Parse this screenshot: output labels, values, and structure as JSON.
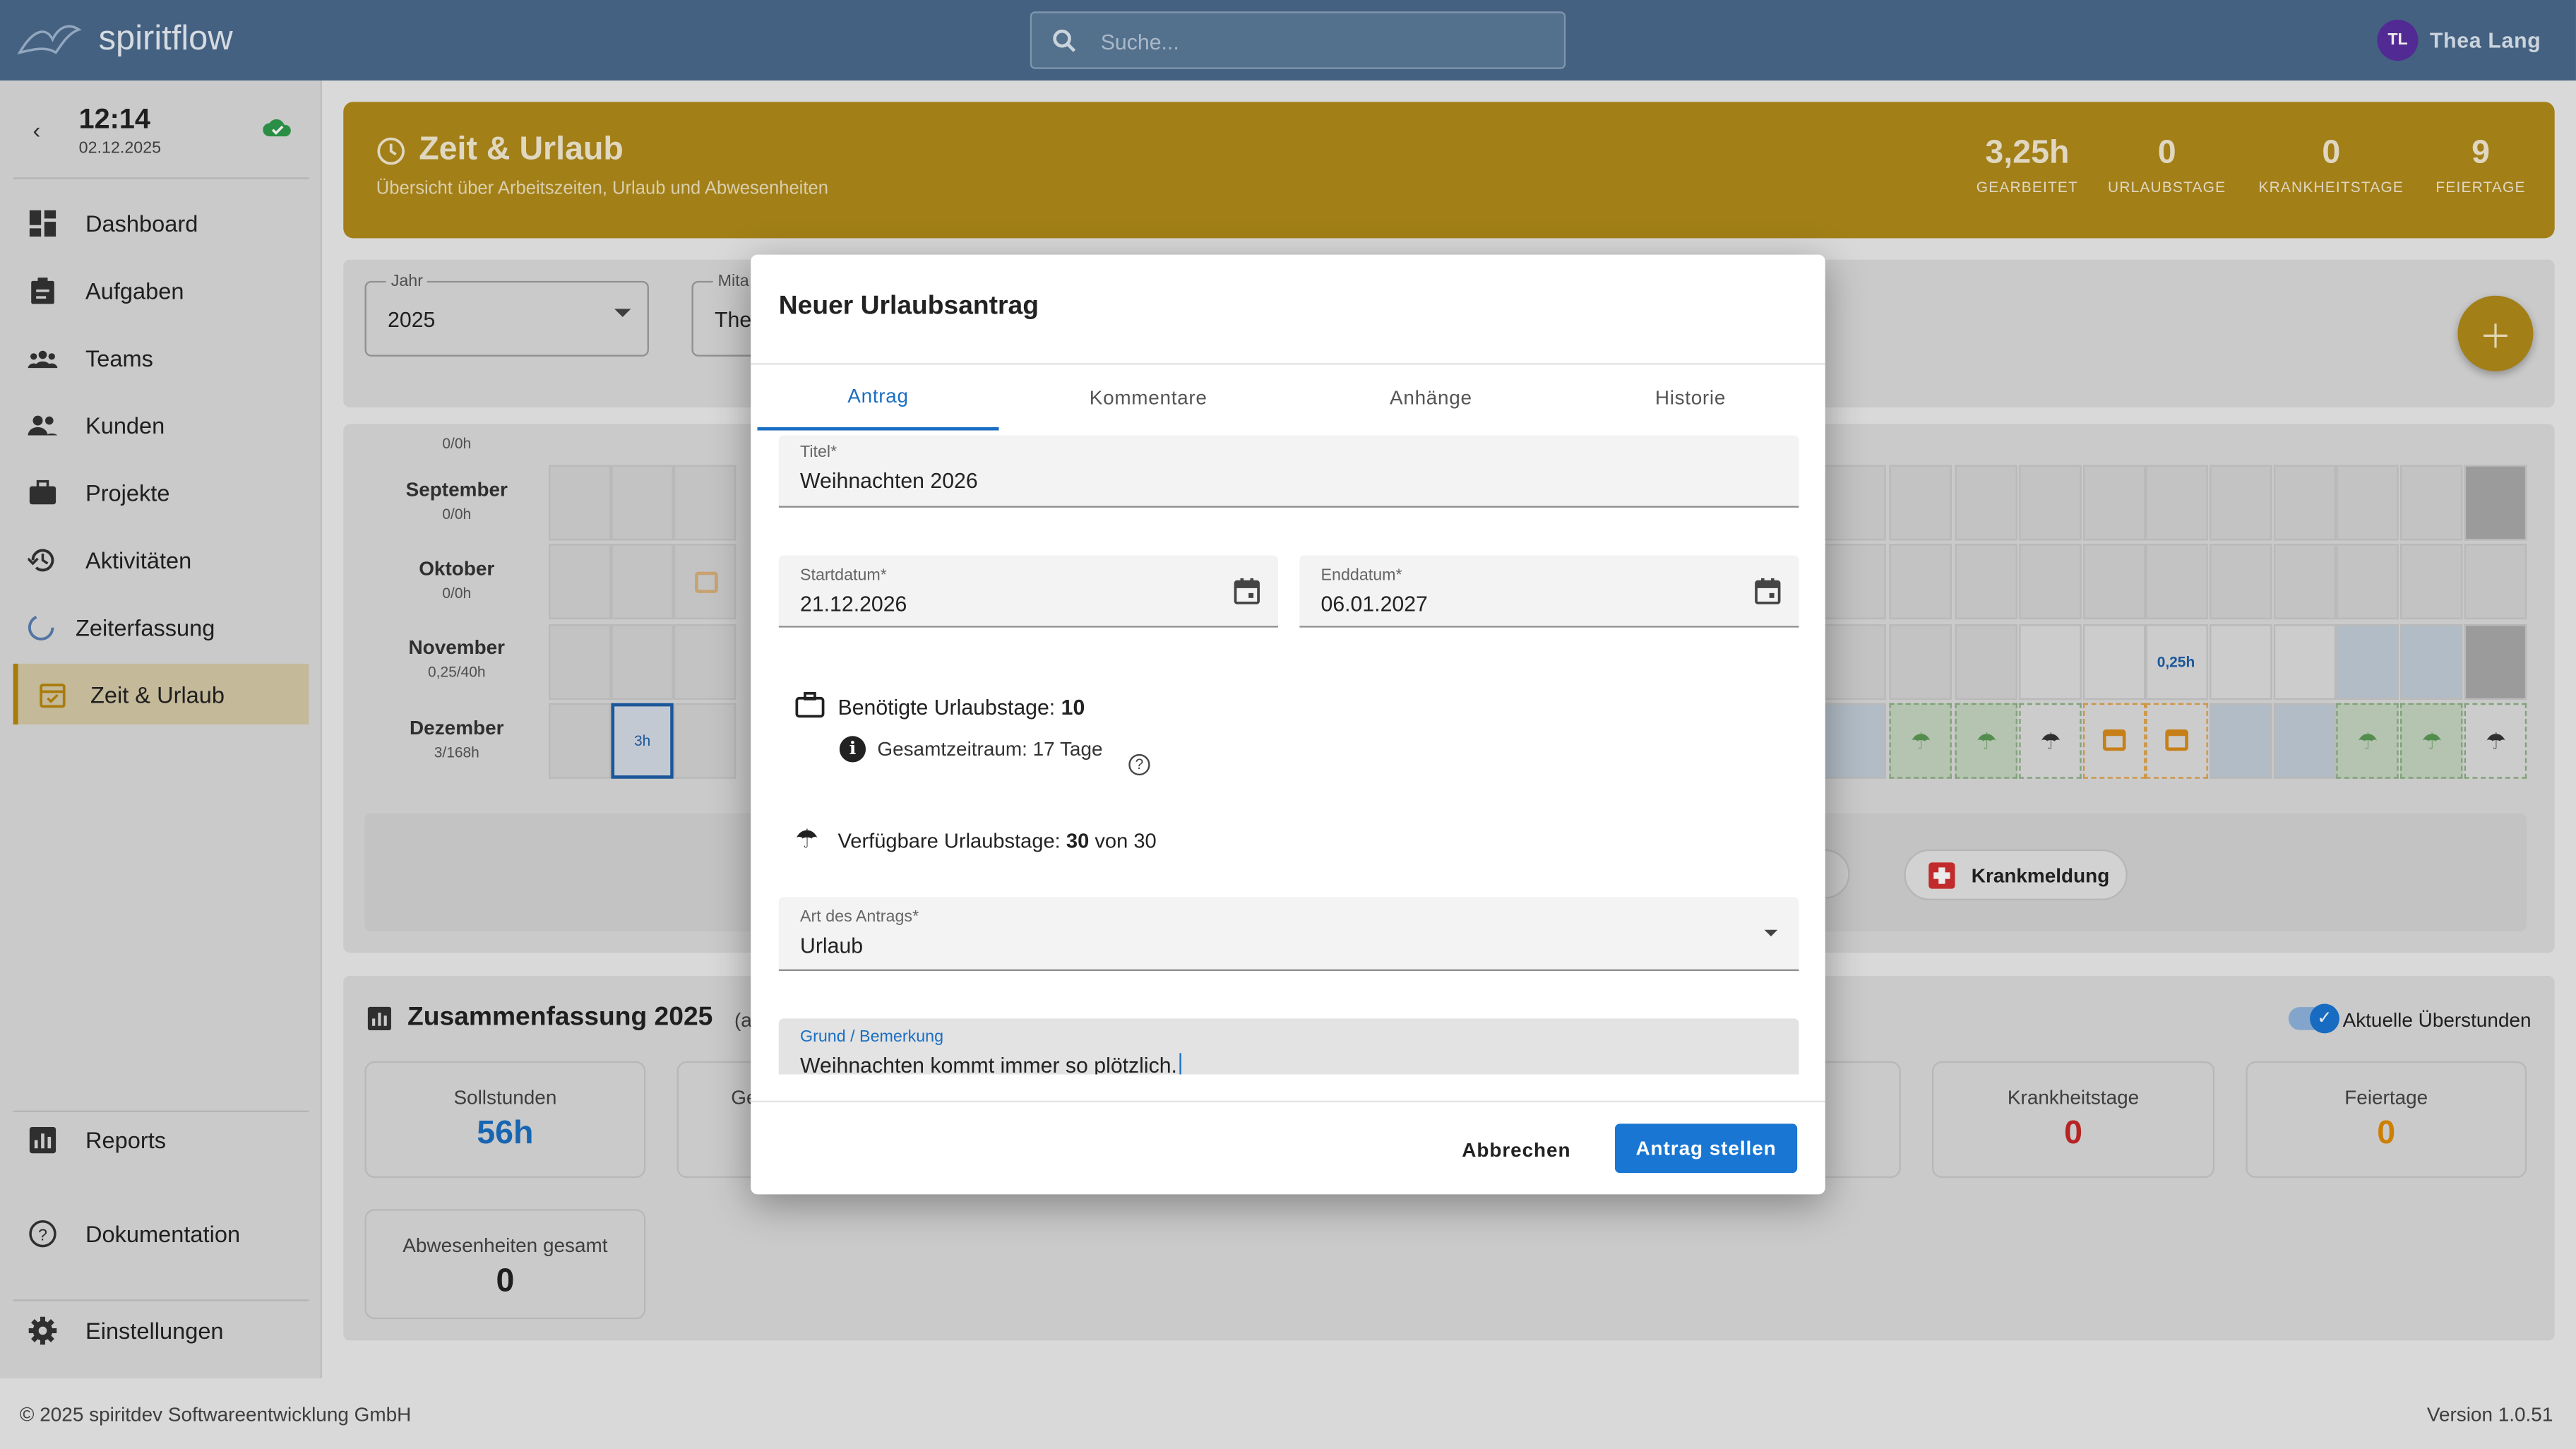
{
  "topbar": {
    "brand": "spiritflow",
    "search_placeholder": "Suche...",
    "user_initials": "TL",
    "user_name": "Thea Lang"
  },
  "sidebar": {
    "clock_time": "12:14",
    "clock_date": "02.12.2025",
    "items": [
      {
        "label": "Dashboard",
        "icon": "dashboard-icon"
      },
      {
        "label": "Aufgaben",
        "icon": "clipboard-icon"
      },
      {
        "label": "Teams",
        "icon": "groups-icon"
      },
      {
        "label": "Kunden",
        "icon": "people-icon"
      },
      {
        "label": "Projekte",
        "icon": "briefcase-icon"
      },
      {
        "label": "Aktivitäten",
        "icon": "history-icon"
      },
      {
        "label": "Zeiterfassung",
        "icon": "progress-icon"
      },
      {
        "label": "Zeit & Urlaub",
        "icon": "calendar-icon"
      }
    ],
    "bottom_items": [
      {
        "label": "Reports",
        "icon": "chart-icon"
      },
      {
        "label": "Dokumentation",
        "icon": "help-icon"
      },
      {
        "label": "Einstellungen",
        "icon": "gear-icon"
      }
    ]
  },
  "banner": {
    "title": "Zeit & Urlaub",
    "subtitle": "Übersicht über Arbeitszeiten, Urlaub und Abwesenheiten",
    "stats": [
      {
        "value": "3,25h",
        "label": "GEARBEITET"
      },
      {
        "value": "0",
        "label": "URLAUBSTAGE"
      },
      {
        "value": "0",
        "label": "KRANKHEITSTAGE"
      },
      {
        "value": "9",
        "label": "FEIERTAGE"
      }
    ]
  },
  "filters": {
    "year_label": "Jahr",
    "year_value": "2025",
    "employee_label": "Mita",
    "employee_value": "The"
  },
  "calendar": {
    "rows": [
      {
        "month": "",
        "hours": "0/0h"
      },
      {
        "month": "September",
        "hours": "0/0h"
      },
      {
        "month": "Oktober",
        "hours": "0/0h"
      },
      {
        "month": "November",
        "hours": "0,25/40h"
      },
      {
        "month": "Dezember",
        "hours": "3/168h"
      }
    ],
    "cell_3h": "3h",
    "cell_025h": "0,25h",
    "sick_button": "Krankmeldung"
  },
  "summary": {
    "title": "Zusammenfassung 2025",
    "title_suffix": "(a",
    "toggle_label": "Aktuelle Überstunden",
    "boxes": [
      {
        "label": "Sollstunden",
        "value": "56h",
        "color": "#1b6ec2"
      },
      {
        "label": "Ge",
        "value": ""
      },
      {
        "label": "Krankheitstage",
        "value": "0",
        "color": "#c62828"
      },
      {
        "label": "Feiertage",
        "value": "0",
        "color": "#e08a00"
      },
      {
        "label": "Abwesenheiten gesamt",
        "value": "0",
        "color": "#222"
      }
    ]
  },
  "footer": {
    "copyright": "© 2025 spiritdev Softwareentwicklung GmbH",
    "version": "Version 1.0.51"
  },
  "dialog": {
    "title": "Neuer Urlaubsantrag",
    "tabs": [
      "Antrag",
      "Kommentare",
      "Anhänge",
      "Historie"
    ],
    "title_field": {
      "label": "Titel*",
      "value": "Weihnachten 2026"
    },
    "start_field": {
      "label": "Startdatum*",
      "value": "21.12.2026"
    },
    "end_field": {
      "label": "Enddatum*",
      "value": "06.01.2027"
    },
    "needed_days_label": "Benötigte Urlaubstage:",
    "needed_days_value": "10",
    "total_period": "Gesamtzeitraum: 17 Tage",
    "available_label": "Verfügbare Urlaubstage:",
    "available_value": "30",
    "available_suffix": "von 30",
    "type_field": {
      "label": "Art des Antrags*",
      "value": "Urlaub"
    },
    "reason_field": {
      "label": "Grund / Bemerkung",
      "value": "Weihnachten kommt immer so plötzlich."
    },
    "cancel_label": "Abbrechen",
    "submit_label": "Antrag stellen"
  }
}
